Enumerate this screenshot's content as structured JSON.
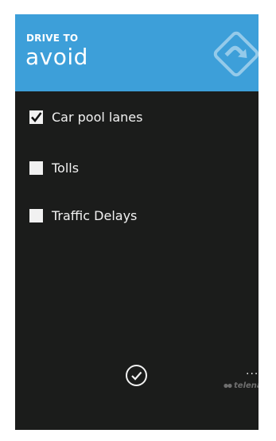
{
  "header": {
    "subtitle": "DRIVE TO",
    "title": "avoid",
    "accent_color": "#3d9fd9",
    "logo_icon": "turn-sign-icon"
  },
  "options": [
    {
      "label": "Car pool lanes",
      "checked": true
    },
    {
      "label": "Tolls",
      "checked": false
    },
    {
      "label": "Traffic Delays",
      "checked": false
    }
  ],
  "appbar": {
    "confirm_icon": "check-circle-icon",
    "more_label": "...",
    "brand": "telenav"
  }
}
